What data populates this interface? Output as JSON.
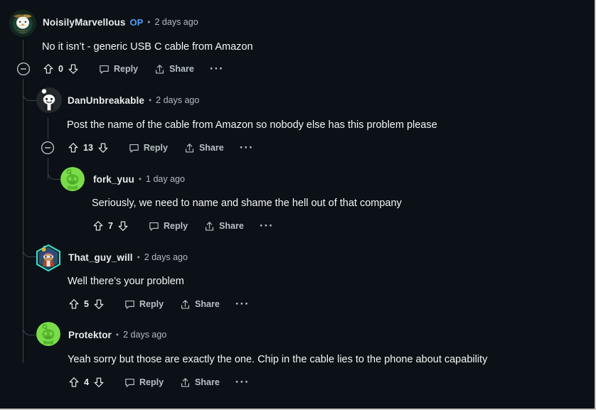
{
  "theme": {
    "background": "#0b1116",
    "text_primary": "#f2f6f7",
    "text_meta": "#b1bcc2",
    "op_badge_color": "#4f9eff",
    "thread_line": "#3a4449"
  },
  "labels": {
    "reply": "Reply",
    "share": "Share",
    "more": "···",
    "separator": "•"
  },
  "comments": [
    {
      "id": "c1",
      "username": "NoisilyMarvellous",
      "op": "OP",
      "age": "2 days ago",
      "body": "No it isn’t - generic USB C cable from Amazon",
      "score": "0",
      "avatar": "eagle-avatar",
      "depth": 0,
      "collapsible": true
    },
    {
      "id": "c2",
      "username": "DanUnbreakable",
      "op": "",
      "age": "2 days ago",
      "body": "Post the name of the cable from Amazon so nobody else has this problem please",
      "score": "13",
      "avatar": "snoo-white-avatar",
      "depth": 1,
      "collapsible": true
    },
    {
      "id": "c3",
      "username": "fork_yuu",
      "op": "",
      "age": "1 day ago",
      "body": "Seriously, we need to name and shame the hell out of that company",
      "score": "7",
      "avatar": "snoo-green-avatar",
      "depth": 2,
      "collapsible": false
    },
    {
      "id": "c4",
      "username": "That_guy_will",
      "op": "",
      "age": "2 days ago",
      "body": "Well there’s your problem",
      "score": "5",
      "avatar": "nft-hex-avatar",
      "depth": 1,
      "collapsible": false
    },
    {
      "id": "c5",
      "username": "Protektor",
      "op": "",
      "age": "2 days ago",
      "body": "Yeah sorry but those are exactly the one. Chip in the cable lies to the phone about capability",
      "score": "4",
      "avatar": "snoo-green-avatar",
      "depth": 1,
      "collapsible": false
    }
  ]
}
